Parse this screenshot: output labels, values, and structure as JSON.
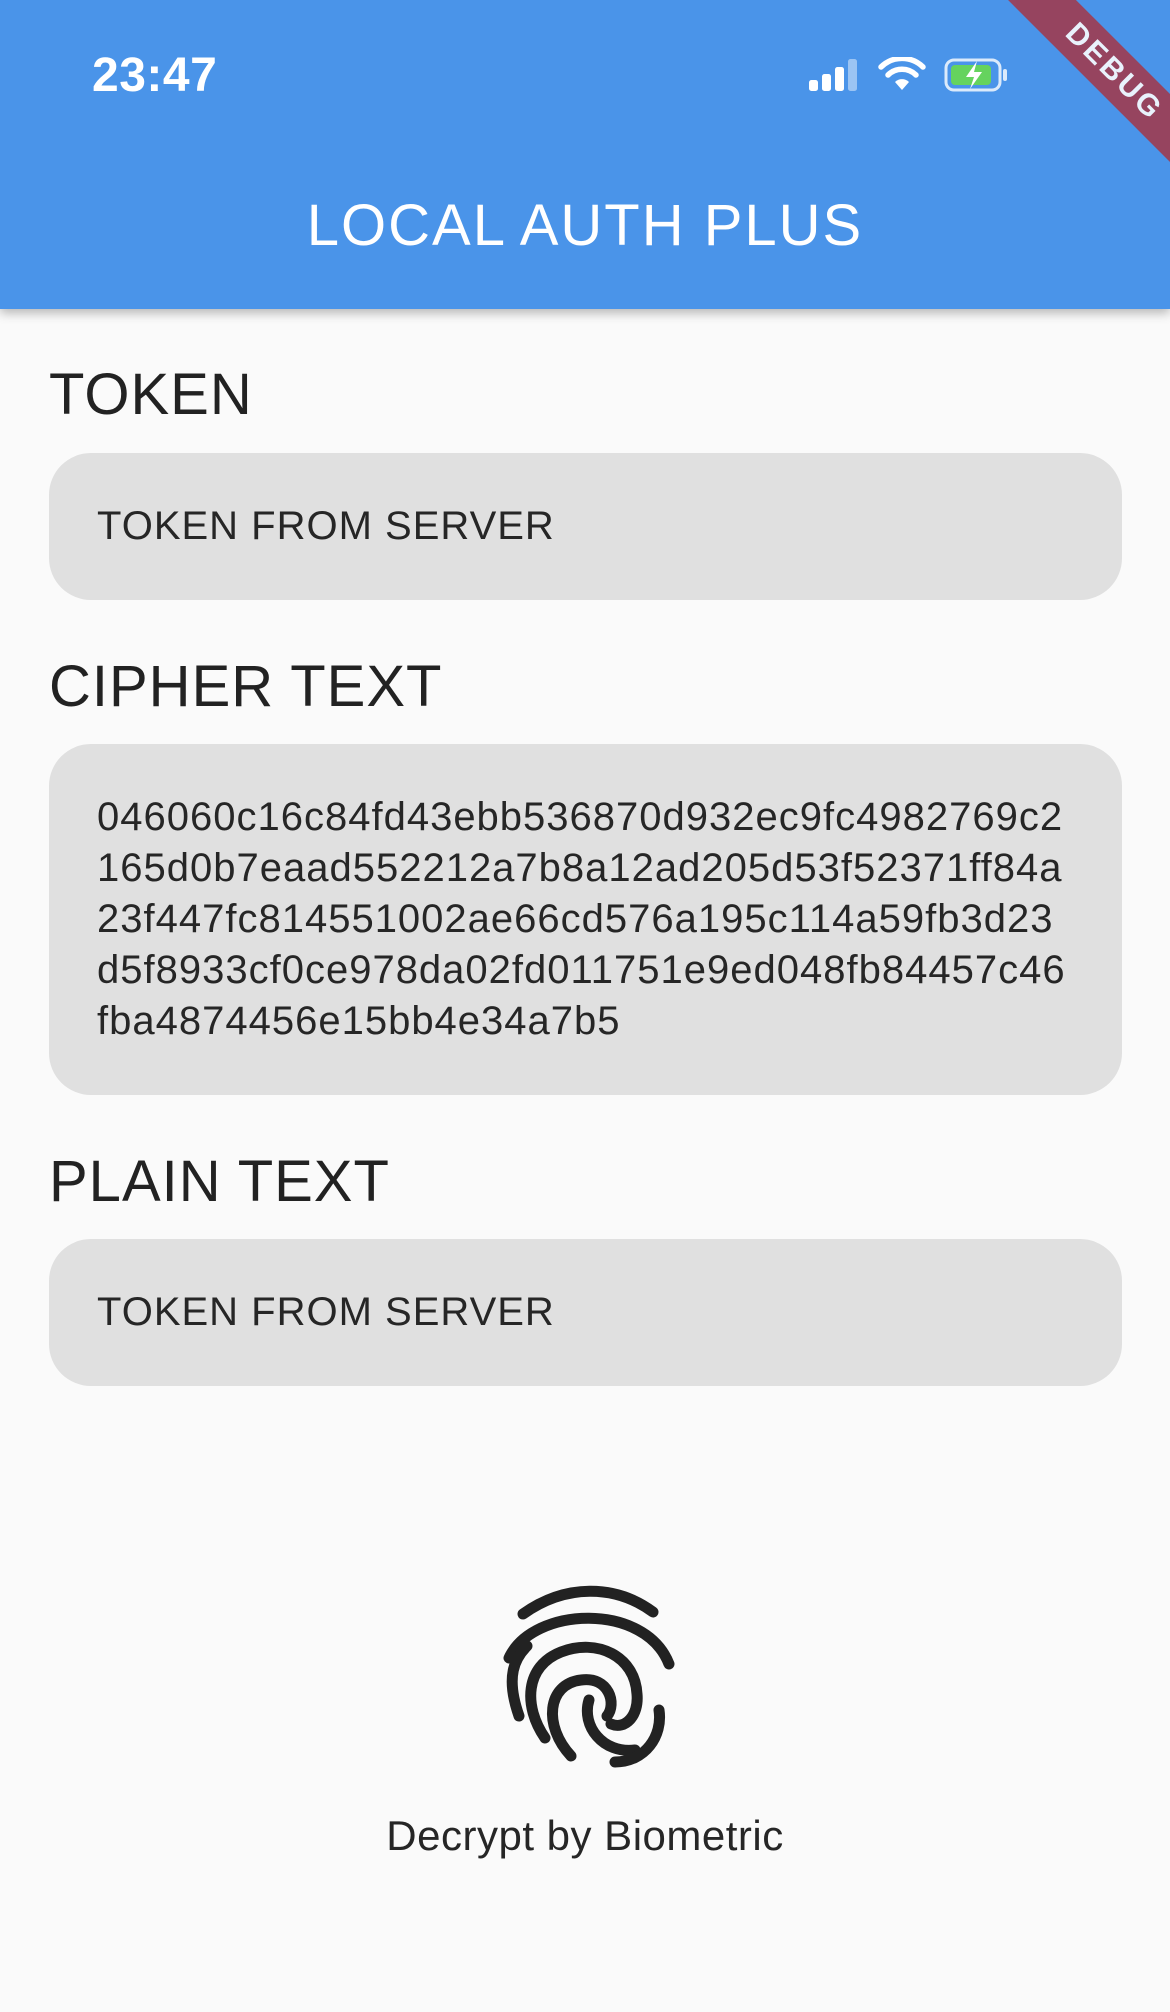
{
  "status_bar": {
    "time": "23:47",
    "icons": [
      "signal-icon",
      "wifi-icon",
      "battery-charging-icon"
    ]
  },
  "app_bar": {
    "title": "LOCAL AUTH PLUS",
    "background_color": "#4a94e9"
  },
  "debug_banner": {
    "label": "DEBUG",
    "color": "#a13a4d"
  },
  "token_section": {
    "label": "TOKEN",
    "value": "TOKEN FROM SERVER"
  },
  "cipher_section": {
    "label": "CIPHER TEXT",
    "value": "046060c16c84fd43ebb536870d932ec9fc4982769c2165d0b7eaad552212a7b8a12ad205d53f52371ff84a23f447fc814551002ae66cd576a195c114a59fb3d23d5f8933cf0ce978da02fd011751e9ed048fb84457c46fba4874456e15bb4e34a7b5"
  },
  "plain_section": {
    "label": "PLAIN TEXT",
    "value": "TOKEN FROM SERVER"
  },
  "biometric_button": {
    "icon": "fingerprint-icon",
    "label": "Decrypt by Biometric"
  }
}
